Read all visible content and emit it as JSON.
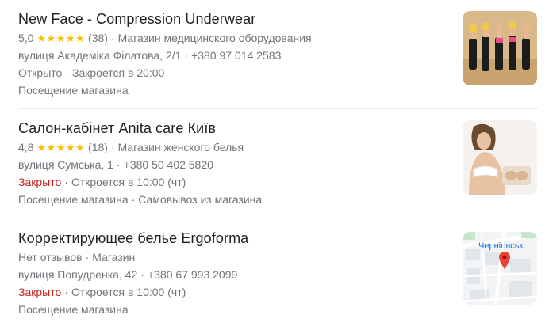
{
  "listings": [
    {
      "name": "New Face - Compression Underwear",
      "rating": "5,0",
      "stars": "★★★★★",
      "reviews": "(38)",
      "category": "Магазин медицинского оборудования",
      "address": "вулиця Академіка Філатова, 2/1",
      "phone": "+380 97 014 2583",
      "status": "Открыто",
      "hours": "Закроется в 20:00",
      "services": "Посещение магазина",
      "thumb": "photo-women-underwear"
    },
    {
      "name": "Салон-кабінет Anita care Київ",
      "rating": "4,8",
      "stars": "★★★★★",
      "reviews": "(18)",
      "category": "Магазин женского белья",
      "address": "вулиця Сумська, 1",
      "phone": "+380 50 402 5820",
      "status": "Закрыто",
      "hours": "Откроется в 10:00 (чт)",
      "services": "Посещение магазина",
      "services2": "Самовывоз из магазина",
      "thumb": "photo-woman-product"
    },
    {
      "name": "Корректирующее белье Ergoforma",
      "no_reviews": "Нет отзывов",
      "category": "Магазин",
      "address": "вулиця Попудренка, 42",
      "phone": "+380 67 993 2099",
      "status": "Закрыто",
      "hours": "Откроется в 10:00 (чт)",
      "services": "Посещение магазина",
      "thumb": "map-thumbnail",
      "map_label": "Чернігівськ"
    }
  ],
  "colors": {
    "open": "#70757a",
    "closed": "#c5221f",
    "star": "#fbbc04",
    "pin": "#ea4335"
  },
  "separator": "·"
}
